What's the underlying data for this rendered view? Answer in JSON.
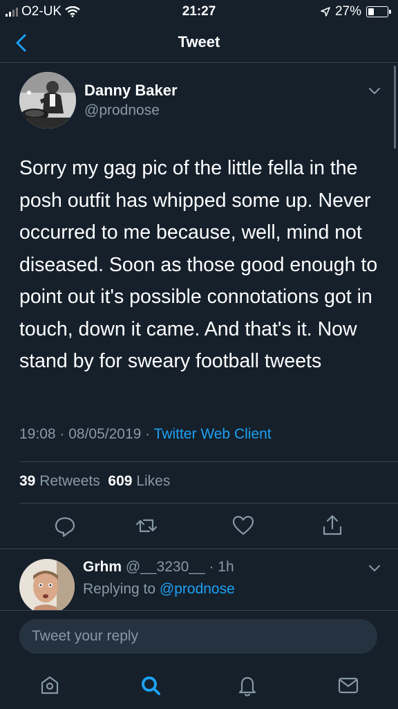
{
  "status_bar": {
    "carrier": "O2-UK",
    "time": "21:27",
    "battery": "27%",
    "battery_level": 0.27
  },
  "nav": {
    "title": "Tweet"
  },
  "tweet": {
    "author_name": "Danny Baker",
    "author_handle": "@prodnose",
    "text": "Sorry my gag pic of the little fella in the posh outfit has whipped some up. Never occurred to me because, well, mind not diseased. Soon as those good enough to point out it's possible connotations got in touch, down it came. And that's it. Now stand by for sweary football tweets",
    "time": "19:08",
    "date": "08/05/2019",
    "client": "Twitter Web Client",
    "retweets_count": "39",
    "retweets_label": "Retweets",
    "likes_count": "609",
    "likes_label": "Likes"
  },
  "reply": {
    "name": "Grhm",
    "handle": "@__3230__",
    "age": "1h",
    "replying_to_label": "Replying to",
    "replying_to": "@prodnose"
  },
  "composer": {
    "placeholder": "Tweet your reply"
  },
  "icons": {
    "back": "chevron-left-icon",
    "caret": "chevron-down-icon",
    "reply": "reply-icon",
    "retweet": "retweet-icon",
    "like": "heart-icon",
    "share": "share-icon",
    "home": "home-icon",
    "search": "search-icon",
    "notifications": "bell-icon",
    "messages": "mail-icon"
  },
  "colors": {
    "background": "#15202b",
    "accent": "#1da1f2",
    "secondary_text": "#8899a6",
    "divider": "#38444d"
  }
}
